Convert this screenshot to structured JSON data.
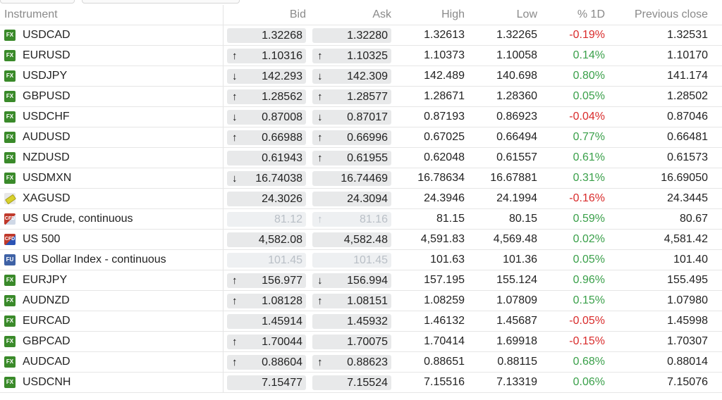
{
  "header": {
    "instrument": "Instrument",
    "bid": "Bid",
    "ask": "Ask",
    "high": "High",
    "low": "Low",
    "pct": "% 1D",
    "prev": "Previous close"
  },
  "rows": [
    {
      "name": "USDCAD",
      "badge": "FX",
      "bid": "1.32268",
      "bid_arrow": "",
      "ask": "1.32280",
      "ask_arrow": "",
      "high": "1.32613",
      "low": "1.32265",
      "pct": "-0.19%",
      "prev": "1.32531"
    },
    {
      "name": "EURUSD",
      "badge": "FX",
      "bid": "1.10316",
      "bid_arrow": "↑",
      "ask": "1.10325",
      "ask_arrow": "↑",
      "high": "1.10373",
      "low": "1.10058",
      "pct": "0.14%",
      "prev": "1.10170"
    },
    {
      "name": "USDJPY",
      "badge": "FX",
      "bid": "142.293",
      "bid_arrow": "↓",
      "ask": "142.309",
      "ask_arrow": "↓",
      "high": "142.489",
      "low": "140.698",
      "pct": "0.80%",
      "prev": "141.174"
    },
    {
      "name": "GBPUSD",
      "badge": "FX",
      "bid": "1.28562",
      "bid_arrow": "↑",
      "ask": "1.28577",
      "ask_arrow": "↑",
      "high": "1.28671",
      "low": "1.28360",
      "pct": "0.05%",
      "prev": "1.28502"
    },
    {
      "name": "USDCHF",
      "badge": "FX",
      "bid": "0.87008",
      "bid_arrow": "↓",
      "ask": "0.87017",
      "ask_arrow": "↓",
      "high": "0.87193",
      "low": "0.86923",
      "pct": "-0.04%",
      "prev": "0.87046"
    },
    {
      "name": "AUDUSD",
      "badge": "FX",
      "bid": "0.66988",
      "bid_arrow": "↑",
      "ask": "0.66996",
      "ask_arrow": "↑",
      "high": "0.67025",
      "low": "0.66494",
      "pct": "0.77%",
      "prev": "0.66481"
    },
    {
      "name": "NZDUSD",
      "badge": "FX",
      "bid": "0.61943",
      "bid_arrow": "",
      "ask": "0.61955",
      "ask_arrow": "↑",
      "high": "0.62048",
      "low": "0.61557",
      "pct": "0.61%",
      "prev": "0.61573"
    },
    {
      "name": "USDMXN",
      "badge": "FX",
      "bid": "16.74038",
      "bid_arrow": "↓",
      "ask": "16.74469",
      "ask_arrow": "",
      "high": "16.78634",
      "low": "16.67881",
      "pct": "0.31%",
      "prev": "16.69050"
    },
    {
      "name": "XAGUSD",
      "badge": "metal",
      "bid": "24.3026",
      "bid_arrow": "",
      "ask": "24.3094",
      "ask_arrow": "",
      "high": "24.3946",
      "low": "24.1994",
      "pct": "-0.16%",
      "prev": "24.3445"
    },
    {
      "name": "US Crude, continuous",
      "badge": "CFD",
      "dim": true,
      "bid": "81.12",
      "bid_arrow": "",
      "ask": "81.16",
      "ask_arrow": "↑",
      "high": "81.15",
      "low": "80.15",
      "pct": "0.59%",
      "prev": "80.67"
    },
    {
      "name": "US 500",
      "badge": "CFD",
      "bid": "4,582.08",
      "bid_arrow": "",
      "ask": "4,582.48",
      "ask_arrow": "",
      "high": "4,591.83",
      "low": "4,569.48",
      "pct": "0.02%",
      "prev": "4,581.42"
    },
    {
      "name": "US Dollar Index - continuous",
      "badge": "FU",
      "dim": true,
      "bid": "101.45",
      "bid_arrow": "",
      "ask": "101.45",
      "ask_arrow": "",
      "high": "101.63",
      "low": "101.36",
      "pct": "0.05%",
      "prev": "101.40"
    },
    {
      "name": "EURJPY",
      "badge": "FX",
      "bid": "156.977",
      "bid_arrow": "↑",
      "ask": "156.994",
      "ask_arrow": "↓",
      "high": "157.195",
      "low": "155.124",
      "pct": "0.96%",
      "prev": "155.495"
    },
    {
      "name": "AUDNZD",
      "badge": "FX",
      "bid": "1.08128",
      "bid_arrow": "↑",
      "ask": "1.08151",
      "ask_arrow": "↑",
      "high": "1.08259",
      "low": "1.07809",
      "pct": "0.15%",
      "prev": "1.07980"
    },
    {
      "name": "EURCAD",
      "badge": "FX",
      "bid": "1.45914",
      "bid_arrow": "",
      "ask": "1.45932",
      "ask_arrow": "",
      "high": "1.46132",
      "low": "1.45687",
      "pct": "-0.05%",
      "prev": "1.45998"
    },
    {
      "name": "GBPCAD",
      "badge": "FX",
      "bid": "1.70044",
      "bid_arrow": "↑",
      "ask": "1.70075",
      "ask_arrow": "",
      "high": "1.70414",
      "low": "1.69918",
      "pct": "-0.15%",
      "prev": "1.70307"
    },
    {
      "name": "AUDCAD",
      "badge": "FX",
      "bid": "0.88604",
      "bid_arrow": "↑",
      "ask": "0.88623",
      "ask_arrow": "↑",
      "high": "0.88651",
      "low": "0.88115",
      "pct": "0.68%",
      "prev": "0.88014"
    },
    {
      "name": "USDCNH",
      "badge": "FX",
      "bid": "7.15477",
      "bid_arrow": "",
      "ask": "7.15524",
      "ask_arrow": "",
      "high": "7.15516",
      "low": "7.13319",
      "pct": "0.06%",
      "prev": "7.15076"
    }
  ],
  "colors": {
    "negative": "#d92b2b",
    "positive": "#3aa04a",
    "badge_fx": "#3a8a2a",
    "badge_fu": "#3f62a6"
  }
}
